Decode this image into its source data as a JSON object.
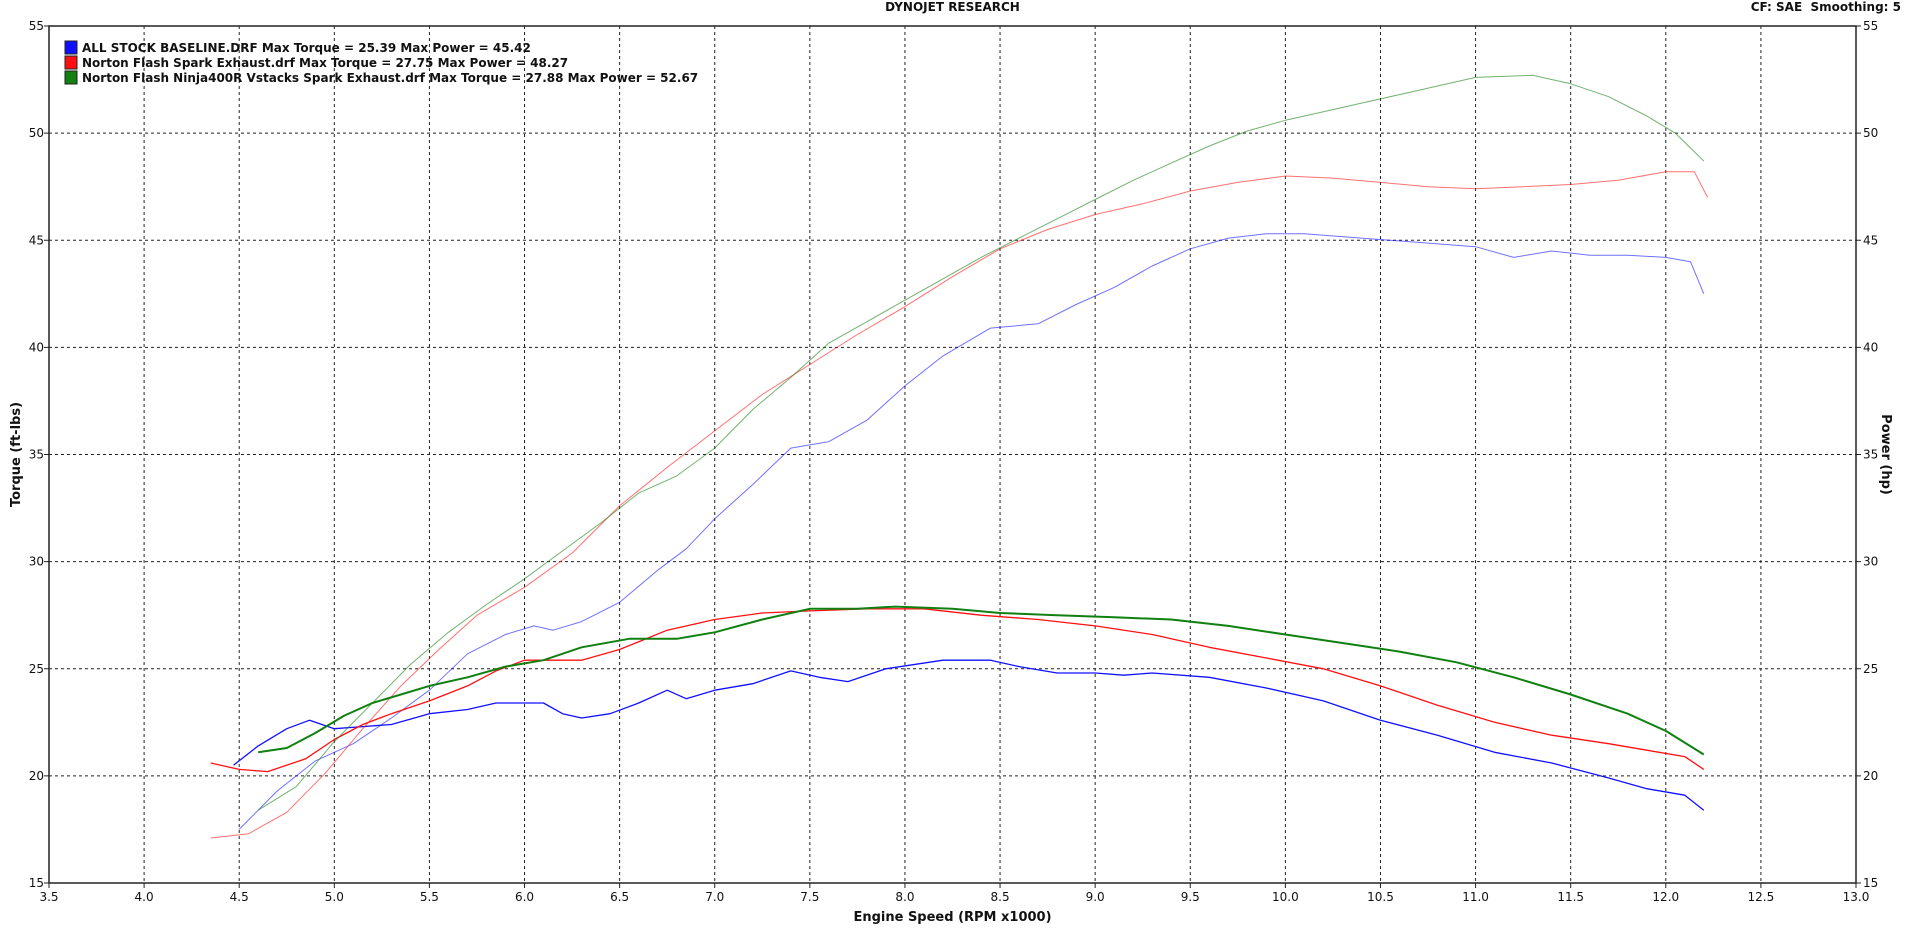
{
  "header": {
    "title": "DYNOJET RESEARCH",
    "cf_label": "CF: SAE",
    "smoothing_label": "Smoothing: 5"
  },
  "chart_data": {
    "type": "line",
    "xlabel": "Engine Speed (RPM x1000)",
    "ylabel_left": "Torque (ft-lbs)",
    "ylabel_right": "Power (hp)",
    "xlim": [
      3.5,
      13.0
    ],
    "ylim": [
      15,
      55
    ],
    "x_ticks": [
      "3.5",
      "4.0",
      "4.5",
      "5.0",
      "5.5",
      "6.0",
      "6.5",
      "7.0",
      "7.5",
      "8.0",
      "8.5",
      "9.0",
      "9.5",
      "10.0",
      "10.5",
      "11.0",
      "11.5",
      "12.0",
      "12.5",
      "13.0"
    ],
    "y_ticks": [
      "15",
      "20",
      "25",
      "30",
      "35",
      "40",
      "45",
      "50",
      "55"
    ],
    "grid": true,
    "legend_position": "top-left",
    "series": [
      {
        "name": "ALL STOCK BASELINE.DRF",
        "legend_label": "ALL STOCK BASELINE.DRF Max Torque = 25.39 Max Power = 45.42",
        "color": "#1010ff",
        "torque": [
          [
            4.47,
            20.5
          ],
          [
            4.6,
            21.4
          ],
          [
            4.75,
            22.2
          ],
          [
            4.87,
            22.6
          ],
          [
            5.0,
            22.2
          ],
          [
            5.15,
            22.3
          ],
          [
            5.3,
            22.4
          ],
          [
            5.5,
            22.9
          ],
          [
            5.7,
            23.1
          ],
          [
            5.85,
            23.4
          ],
          [
            6.1,
            23.4
          ],
          [
            6.2,
            22.9
          ],
          [
            6.3,
            22.7
          ],
          [
            6.45,
            22.9
          ],
          [
            6.6,
            23.4
          ],
          [
            6.75,
            24.0
          ],
          [
            6.85,
            23.6
          ],
          [
            7.0,
            24.0
          ],
          [
            7.2,
            24.3
          ],
          [
            7.4,
            24.9
          ],
          [
            7.55,
            24.6
          ],
          [
            7.7,
            24.4
          ],
          [
            7.9,
            25.0
          ],
          [
            8.2,
            25.4
          ],
          [
            8.45,
            25.4
          ],
          [
            8.6,
            25.1
          ],
          [
            8.8,
            24.8
          ],
          [
            9.0,
            24.8
          ],
          [
            9.15,
            24.7
          ],
          [
            9.3,
            24.8
          ],
          [
            9.6,
            24.6
          ],
          [
            9.9,
            24.1
          ],
          [
            10.2,
            23.5
          ],
          [
            10.5,
            22.6
          ],
          [
            10.8,
            21.9
          ],
          [
            11.1,
            21.1
          ],
          [
            11.4,
            20.6
          ],
          [
            11.7,
            19.9
          ],
          [
            11.9,
            19.4
          ],
          [
            12.1,
            19.1
          ],
          [
            12.2,
            18.4
          ]
        ],
        "power": [
          [
            4.5,
            17.5
          ],
          [
            4.7,
            19.3
          ],
          [
            4.9,
            20.7
          ],
          [
            5.1,
            21.5
          ],
          [
            5.3,
            22.7
          ],
          [
            5.5,
            24.0
          ],
          [
            5.7,
            25.7
          ],
          [
            5.9,
            26.6
          ],
          [
            6.05,
            27.0
          ],
          [
            6.15,
            26.8
          ],
          [
            6.3,
            27.2
          ],
          [
            6.5,
            28.1
          ],
          [
            6.7,
            29.6
          ],
          [
            6.85,
            30.6
          ],
          [
            7.0,
            32.0
          ],
          [
            7.2,
            33.6
          ],
          [
            7.4,
            35.3
          ],
          [
            7.6,
            35.6
          ],
          [
            7.8,
            36.6
          ],
          [
            8.0,
            38.2
          ],
          [
            8.2,
            39.6
          ],
          [
            8.45,
            40.9
          ],
          [
            8.7,
            41.1
          ],
          [
            8.9,
            42.0
          ],
          [
            9.1,
            42.8
          ],
          [
            9.3,
            43.8
          ],
          [
            9.5,
            44.6
          ],
          [
            9.7,
            45.1
          ],
          [
            9.9,
            45.3
          ],
          [
            10.1,
            45.3
          ],
          [
            10.4,
            45.1
          ],
          [
            10.7,
            44.9
          ],
          [
            11.0,
            44.7
          ],
          [
            11.2,
            44.2
          ],
          [
            11.4,
            44.5
          ],
          [
            11.6,
            44.3
          ],
          [
            11.8,
            44.3
          ],
          [
            12.0,
            44.2
          ],
          [
            12.13,
            44.0
          ],
          [
            12.2,
            42.5
          ]
        ]
      },
      {
        "name": "Norton Flash Spark Exhaust.drf",
        "legend_label": "Norton Flash Spark Exhaust.drf Max Torque = 27.75 Max Power = 48.27",
        "color": "#ff1010",
        "torque": [
          [
            4.35,
            20.6
          ],
          [
            4.5,
            20.3
          ],
          [
            4.65,
            20.2
          ],
          [
            4.85,
            20.8
          ],
          [
            5.0,
            21.7
          ],
          [
            5.15,
            22.4
          ],
          [
            5.3,
            22.9
          ],
          [
            5.5,
            23.5
          ],
          [
            5.7,
            24.2
          ],
          [
            5.85,
            24.9
          ],
          [
            6.0,
            25.4
          ],
          [
            6.15,
            25.4
          ],
          [
            6.3,
            25.4
          ],
          [
            6.5,
            25.9
          ],
          [
            6.75,
            26.8
          ],
          [
            7.0,
            27.3
          ],
          [
            7.25,
            27.6
          ],
          [
            7.5,
            27.7
          ],
          [
            7.8,
            27.8
          ],
          [
            8.1,
            27.8
          ],
          [
            8.4,
            27.5
          ],
          [
            8.7,
            27.3
          ],
          [
            9.0,
            27.0
          ],
          [
            9.3,
            26.6
          ],
          [
            9.6,
            26.0
          ],
          [
            9.9,
            25.5
          ],
          [
            10.2,
            25.0
          ],
          [
            10.5,
            24.2
          ],
          [
            10.8,
            23.3
          ],
          [
            11.1,
            22.5
          ],
          [
            11.4,
            21.9
          ],
          [
            11.7,
            21.5
          ],
          [
            11.9,
            21.2
          ],
          [
            12.1,
            20.9
          ],
          [
            12.2,
            20.3
          ]
        ],
        "power": [
          [
            4.35,
            17.1
          ],
          [
            4.55,
            17.3
          ],
          [
            4.75,
            18.3
          ],
          [
            4.95,
            20.1
          ],
          [
            5.15,
            22.2
          ],
          [
            5.35,
            24.2
          ],
          [
            5.55,
            25.9
          ],
          [
            5.75,
            27.5
          ],
          [
            6.0,
            28.8
          ],
          [
            6.25,
            30.4
          ],
          [
            6.5,
            32.6
          ],
          [
            6.75,
            34.4
          ],
          [
            7.0,
            36.1
          ],
          [
            7.25,
            37.8
          ],
          [
            7.5,
            39.2
          ],
          [
            7.75,
            40.6
          ],
          [
            8.0,
            41.9
          ],
          [
            8.25,
            43.3
          ],
          [
            8.5,
            44.6
          ],
          [
            8.75,
            45.5
          ],
          [
            9.0,
            46.2
          ],
          [
            9.25,
            46.7
          ],
          [
            9.5,
            47.3
          ],
          [
            9.75,
            47.7
          ],
          [
            10.0,
            48.0
          ],
          [
            10.25,
            47.9
          ],
          [
            10.5,
            47.7
          ],
          [
            10.75,
            47.5
          ],
          [
            11.0,
            47.4
          ],
          [
            11.25,
            47.5
          ],
          [
            11.5,
            47.6
          ],
          [
            11.75,
            47.8
          ],
          [
            12.0,
            48.2
          ],
          [
            12.15,
            48.2
          ],
          [
            12.22,
            47.0
          ]
        ]
      },
      {
        "name": "Norton Flash Ninja400R Vstacks Spark Exhaust.drf",
        "legend_label": "Norton Flash Ninja400R Vstacks Spark Exhaust.drf Max Torque = 27.88 Max Power = 52.67",
        "color": "#108010",
        "torque": [
          [
            4.6,
            21.1
          ],
          [
            4.75,
            21.3
          ],
          [
            4.9,
            22.0
          ],
          [
            5.05,
            22.8
          ],
          [
            5.2,
            23.4
          ],
          [
            5.35,
            23.8
          ],
          [
            5.5,
            24.2
          ],
          [
            5.7,
            24.6
          ],
          [
            5.9,
            25.1
          ],
          [
            6.1,
            25.4
          ],
          [
            6.3,
            26.0
          ],
          [
            6.55,
            26.4
          ],
          [
            6.8,
            26.4
          ],
          [
            7.0,
            26.7
          ],
          [
            7.25,
            27.3
          ],
          [
            7.5,
            27.8
          ],
          [
            7.75,
            27.8
          ],
          [
            7.95,
            27.9
          ],
          [
            8.25,
            27.8
          ],
          [
            8.5,
            27.6
          ],
          [
            8.8,
            27.5
          ],
          [
            9.1,
            27.4
          ],
          [
            9.4,
            27.3
          ],
          [
            9.7,
            27.0
          ],
          [
            10.0,
            26.6
          ],
          [
            10.3,
            26.2
          ],
          [
            10.6,
            25.8
          ],
          [
            10.9,
            25.3
          ],
          [
            11.2,
            24.6
          ],
          [
            11.5,
            23.8
          ],
          [
            11.8,
            22.9
          ],
          [
            12.0,
            22.1
          ],
          [
            12.2,
            21.0
          ]
        ],
        "power": [
          [
            4.6,
            18.4
          ],
          [
            4.8,
            19.5
          ],
          [
            5.0,
            21.6
          ],
          [
            5.2,
            23.4
          ],
          [
            5.4,
            25.2
          ],
          [
            5.6,
            26.7
          ],
          [
            5.8,
            28.0
          ],
          [
            6.0,
            29.2
          ],
          [
            6.2,
            30.5
          ],
          [
            6.4,
            31.8
          ],
          [
            6.6,
            33.2
          ],
          [
            6.8,
            34.0
          ],
          [
            7.0,
            35.3
          ],
          [
            7.2,
            37.1
          ],
          [
            7.4,
            38.6
          ],
          [
            7.6,
            40.2
          ],
          [
            7.8,
            41.2
          ],
          [
            8.0,
            42.2
          ],
          [
            8.2,
            43.2
          ],
          [
            8.4,
            44.2
          ],
          [
            8.6,
            45.1
          ],
          [
            8.8,
            46.0
          ],
          [
            9.0,
            46.9
          ],
          [
            9.2,
            47.8
          ],
          [
            9.4,
            48.6
          ],
          [
            9.6,
            49.4
          ],
          [
            9.8,
            50.1
          ],
          [
            10.0,
            50.6
          ],
          [
            10.2,
            51.0
          ],
          [
            10.4,
            51.4
          ],
          [
            10.6,
            51.8
          ],
          [
            10.8,
            52.2
          ],
          [
            11.0,
            52.6
          ],
          [
            11.3,
            52.7
          ],
          [
            11.5,
            52.3
          ],
          [
            11.7,
            51.7
          ],
          [
            11.9,
            50.8
          ],
          [
            12.05,
            50.0
          ],
          [
            12.2,
            48.7
          ]
        ]
      }
    ]
  }
}
